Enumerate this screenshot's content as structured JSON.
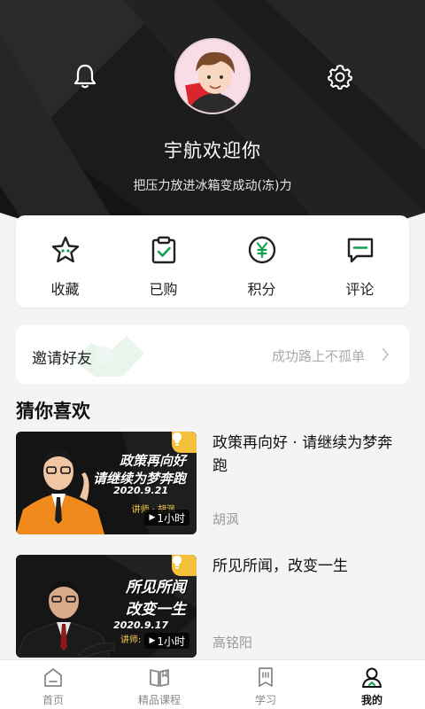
{
  "profile": {
    "username": "宇航欢迎你",
    "signature": "把压力放进冰箱变成动(冻)力"
  },
  "quick_actions": [
    {
      "label": "收藏",
      "icon": "star-icon"
    },
    {
      "label": "已购",
      "icon": "purchased-clipboard-icon"
    },
    {
      "label": "积分",
      "icon": "yuan-points-icon"
    },
    {
      "label": "评论",
      "icon": "comment-icon"
    }
  ],
  "invite": {
    "title": "邀请好友",
    "hint": "成功路上不孤单"
  },
  "recommend": {
    "title": "猜你喜欢",
    "courses": [
      {
        "title": "政策再向好 · 请继续为梦奔跑",
        "author": "胡沨",
        "thumb_line1": "政策再向好",
        "thumb_line2": "请继续为梦奔跑",
        "thumb_date": "2020.9.21",
        "thumb_lecturer": "讲师 · 胡沨",
        "duration": "1小时"
      },
      {
        "title": "所见所闻，改变一生",
        "author": "高铭阳",
        "thumb_line1": "所见所闻",
        "thumb_line2": "改变一生",
        "thumb_date": "2020.9.17",
        "thumb_lecturer": "讲师:",
        "duration": "1小时"
      }
    ]
  },
  "tabs": [
    {
      "label": "首页",
      "icon": "home-icon",
      "active": false
    },
    {
      "label": "精品课程",
      "icon": "book-icon",
      "active": false
    },
    {
      "label": "学习",
      "icon": "study-bookmark-icon",
      "active": false
    },
    {
      "label": "我的",
      "icon": "profile-icon",
      "active": true
    }
  ],
  "colors": {
    "accent": "#12a150",
    "hero_bg": "#1c1c1c",
    "thumb_title": "#ffffff",
    "badge": "#f5c03a"
  }
}
